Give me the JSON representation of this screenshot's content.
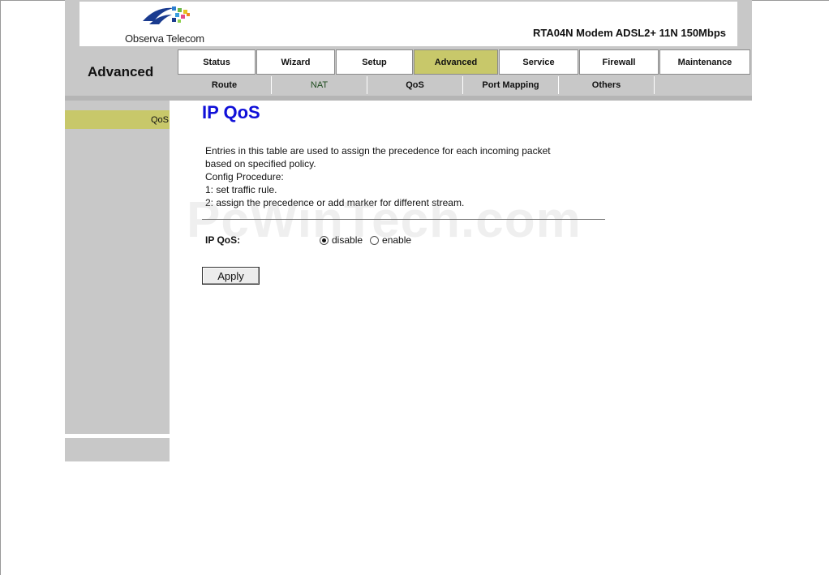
{
  "header": {
    "logo_text": "Observa Telecom",
    "product": "RTA04N Modem ADSL2+ 11N 150Mbps"
  },
  "section_title": "Advanced",
  "main_tabs": [
    {
      "label": "Status",
      "active": false
    },
    {
      "label": "Wizard",
      "active": false
    },
    {
      "label": "Setup",
      "active": false
    },
    {
      "label": "Advanced",
      "active": true
    },
    {
      "label": "Service",
      "active": false
    },
    {
      "label": "Firewall",
      "active": false
    },
    {
      "label": "Maintenance",
      "active": false
    }
  ],
  "sub_tabs": [
    {
      "label": "Route",
      "active": false
    },
    {
      "label": "NAT",
      "active": true
    },
    {
      "label": "QoS",
      "active": false
    },
    {
      "label": "Port Mapping",
      "active": false
    },
    {
      "label": "Others",
      "active": false
    },
    {
      "label": "",
      "active": false
    }
  ],
  "sidebar": {
    "items": [
      {
        "label": "QoS",
        "active": true
      }
    ]
  },
  "page": {
    "title": "IP QoS",
    "description": [
      "Entries in this table are used to assign the precedence for each incoming packet",
      "based on specified policy.",
      "Config Procedure:",
      "1: set traffic rule.",
      "2: assign the precedence or add marker for different stream."
    ],
    "qos_label": "IP QoS:",
    "options": [
      {
        "label": "disable",
        "checked": true
      },
      {
        "label": "enable",
        "checked": false
      }
    ],
    "apply_label": "Apply"
  },
  "watermark": "PcWinTech.com",
  "colors": {
    "active_tab": "#c8c86a",
    "title_blue": "#1010d8",
    "panel_gray": "#c8c8c8"
  }
}
